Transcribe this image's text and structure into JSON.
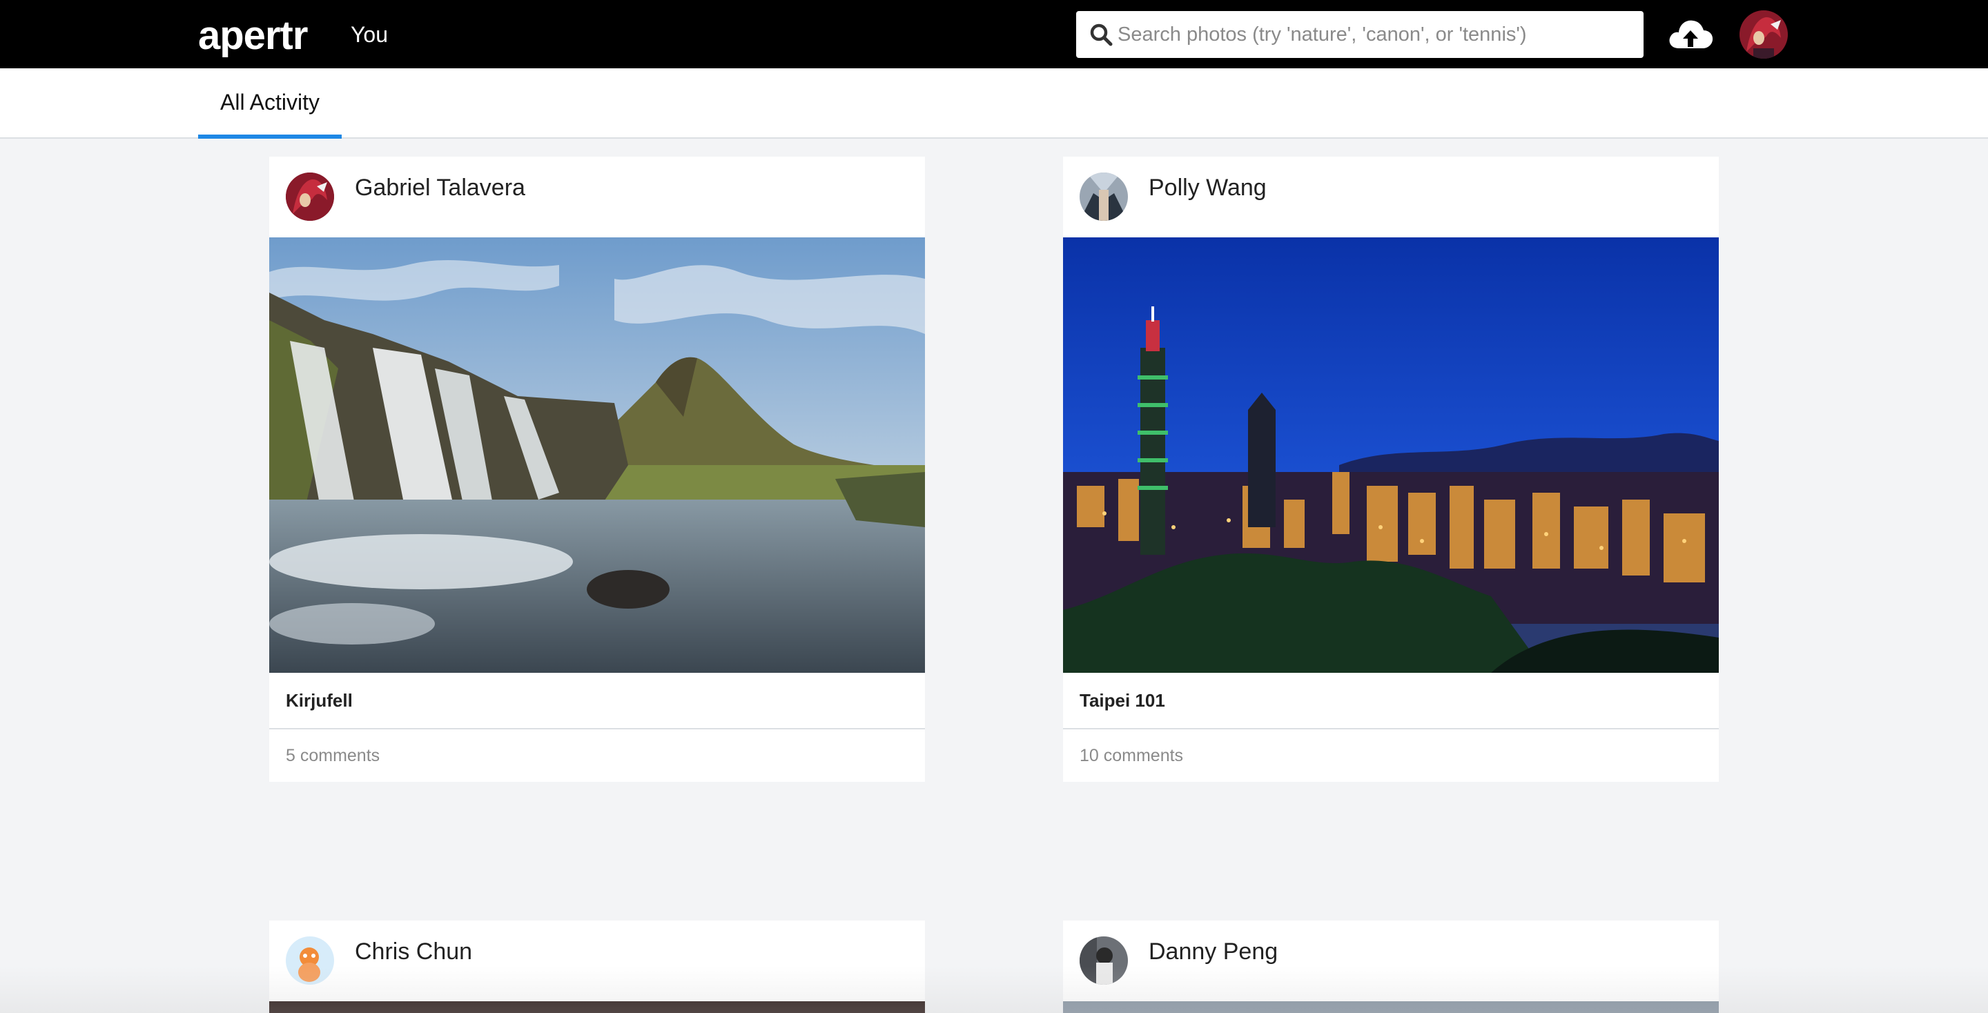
{
  "app": {
    "logo": "apertr",
    "nav_you": "You"
  },
  "search": {
    "placeholder": "Search photos (try 'nature', 'canon', or 'tennis')"
  },
  "icons": {
    "search": "search-icon",
    "upload": "cloud-upload-icon"
  },
  "tabs": [
    {
      "label": "All Activity",
      "active": true
    }
  ],
  "colors": {
    "accent": "#1e88e5",
    "topbar": "#000000",
    "background": "#f3f4f6"
  },
  "feed": [
    {
      "author": "Gabriel Talavera",
      "title": "Kirjufell",
      "comments": "5 comments"
    },
    {
      "author": "Polly Wang",
      "title": "Taipei 101",
      "comments": "10 comments"
    },
    {
      "author": "Chris Chun"
    },
    {
      "author": "Danny Peng"
    }
  ]
}
